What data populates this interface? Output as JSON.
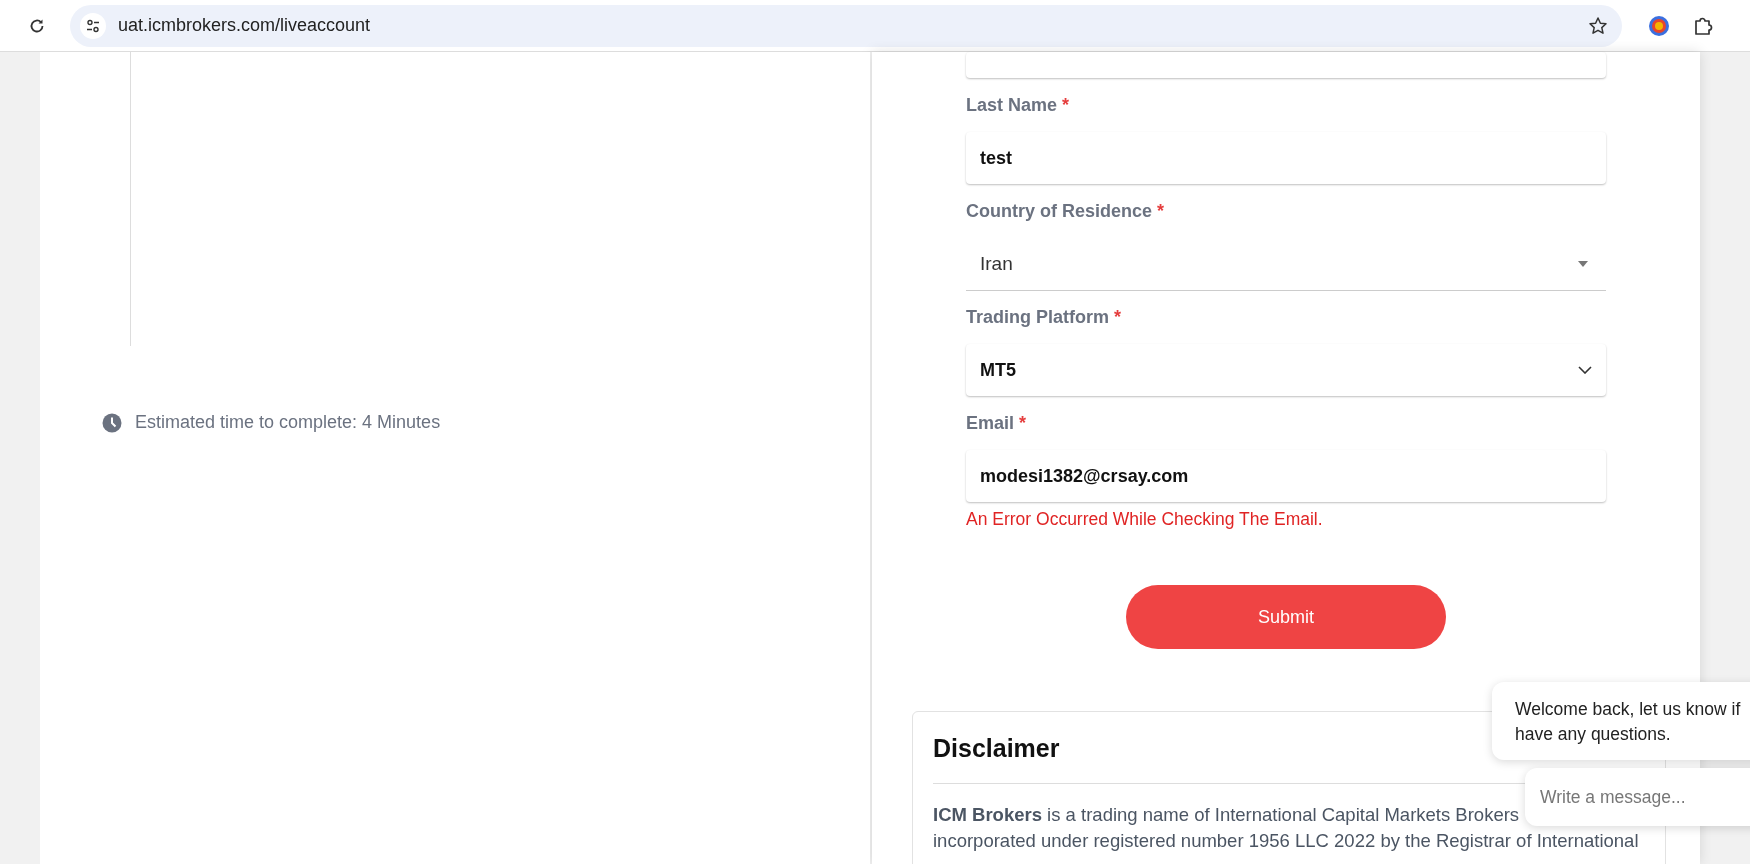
{
  "browser": {
    "url": "uat.icmbrokers.com/liveaccount"
  },
  "sidebar": {
    "estimate": "Estimated time to complete: 4 Minutes"
  },
  "form": {
    "fields": [
      {
        "kind": "text",
        "label": "Last Name",
        "required_mark": "*",
        "value": "test"
      },
      {
        "kind": "native-select",
        "label": "Country of Residence",
        "required_mark": "*",
        "value": "Iran"
      },
      {
        "kind": "select",
        "label": "Trading Platform",
        "required_mark": "*",
        "value": "MT5"
      },
      {
        "kind": "text",
        "label": "Email",
        "required_mark": "*",
        "value": "modesi1382@crsay.com",
        "error": "An Error Occurred While Checking The Email."
      }
    ],
    "submit": "Submit"
  },
  "disclaimer": {
    "title": "Disclaimer",
    "lines": [
      "**ICM Brokers** is a trading name of International Capital Markets Brokers",
      "incorporated under registered number 1956 LLC 2022 by the Registrar of International"
    ]
  },
  "chat": {
    "message_lines": [
      "Welcome back, let us know if",
      "have any questions."
    ],
    "placeholder": "Write a message..."
  }
}
